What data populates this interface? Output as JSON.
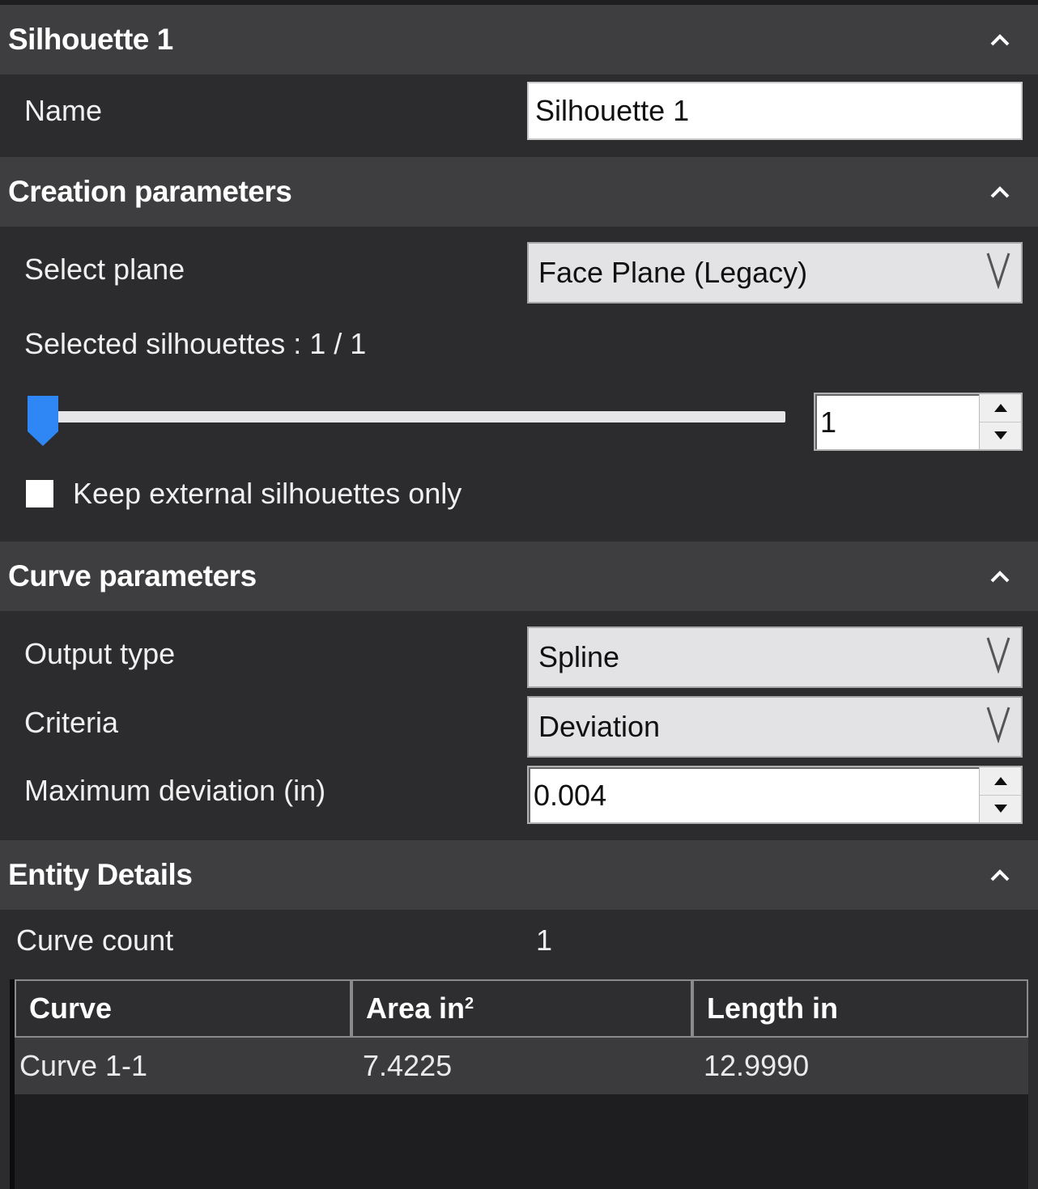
{
  "sections": {
    "silhouette": {
      "title": "Silhouette 1"
    },
    "creation": {
      "title": "Creation parameters"
    },
    "curve": {
      "title": "Curve parameters"
    },
    "entity": {
      "title": "Entity Details"
    }
  },
  "name_field": {
    "label": "Name",
    "value": "Silhouette 1"
  },
  "select_plane": {
    "label": "Select plane",
    "value": "Face Plane (Legacy)"
  },
  "selected_silhouettes": {
    "label": "Selected silhouettes : 1 / 1",
    "slider_value": 1,
    "slider_min": 1,
    "slider_max": 1,
    "spin_value": "1"
  },
  "keep_external": {
    "label": "Keep external silhouettes only",
    "checked": false
  },
  "output_type": {
    "label": "Output type",
    "value": "Spline"
  },
  "criteria": {
    "label": "Criteria",
    "value": "Deviation"
  },
  "max_deviation": {
    "label": "Maximum deviation (in)",
    "value": "0.004"
  },
  "curve_count": {
    "label": "Curve count",
    "value": "1"
  },
  "table": {
    "columns": [
      {
        "label": "Curve",
        "sup": ""
      },
      {
        "label": "Area in",
        "sup": "2"
      },
      {
        "label": "Length in",
        "sup": ""
      }
    ],
    "rows": [
      {
        "curve": "Curve 1-1",
        "area": "7.4225",
        "length": "12.9990"
      }
    ]
  },
  "colors": {
    "accent": "#2f86f5",
    "header_bg": "#3e3d40",
    "panel_bg": "#2c2b2e"
  }
}
